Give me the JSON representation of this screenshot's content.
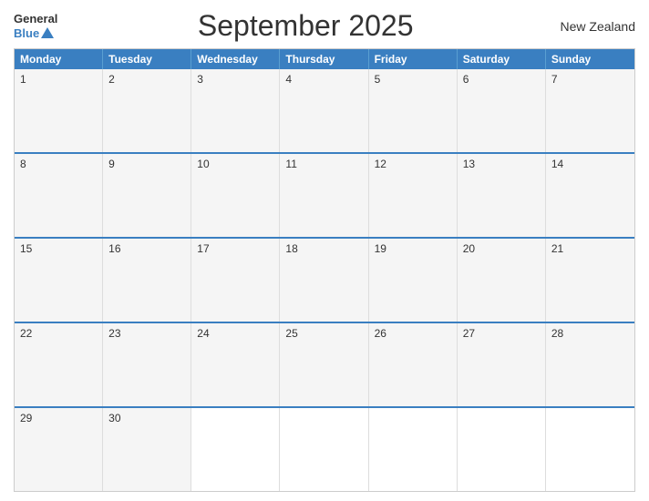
{
  "header": {
    "logo_general": "General",
    "logo_blue": "Blue",
    "title": "September 2025",
    "country": "New Zealand"
  },
  "calendar": {
    "days_of_week": [
      "Monday",
      "Tuesday",
      "Wednesday",
      "Thursday",
      "Friday",
      "Saturday",
      "Sunday"
    ],
    "weeks": [
      [
        {
          "day": "1",
          "empty": false
        },
        {
          "day": "2",
          "empty": false
        },
        {
          "day": "3",
          "empty": false
        },
        {
          "day": "4",
          "empty": false
        },
        {
          "day": "5",
          "empty": false
        },
        {
          "day": "6",
          "empty": false
        },
        {
          "day": "7",
          "empty": false
        }
      ],
      [
        {
          "day": "8",
          "empty": false
        },
        {
          "day": "9",
          "empty": false
        },
        {
          "day": "10",
          "empty": false
        },
        {
          "day": "11",
          "empty": false
        },
        {
          "day": "12",
          "empty": false
        },
        {
          "day": "13",
          "empty": false
        },
        {
          "day": "14",
          "empty": false
        }
      ],
      [
        {
          "day": "15",
          "empty": false
        },
        {
          "day": "16",
          "empty": false
        },
        {
          "day": "17",
          "empty": false
        },
        {
          "day": "18",
          "empty": false
        },
        {
          "day": "19",
          "empty": false
        },
        {
          "day": "20",
          "empty": false
        },
        {
          "day": "21",
          "empty": false
        }
      ],
      [
        {
          "day": "22",
          "empty": false
        },
        {
          "day": "23",
          "empty": false
        },
        {
          "day": "24",
          "empty": false
        },
        {
          "day": "25",
          "empty": false
        },
        {
          "day": "26",
          "empty": false
        },
        {
          "day": "27",
          "empty": false
        },
        {
          "day": "28",
          "empty": false
        }
      ],
      [
        {
          "day": "29",
          "empty": false
        },
        {
          "day": "30",
          "empty": false
        },
        {
          "day": "",
          "empty": true
        },
        {
          "day": "",
          "empty": true
        },
        {
          "day": "",
          "empty": true
        },
        {
          "day": "",
          "empty": true
        },
        {
          "day": "",
          "empty": true
        }
      ]
    ]
  }
}
